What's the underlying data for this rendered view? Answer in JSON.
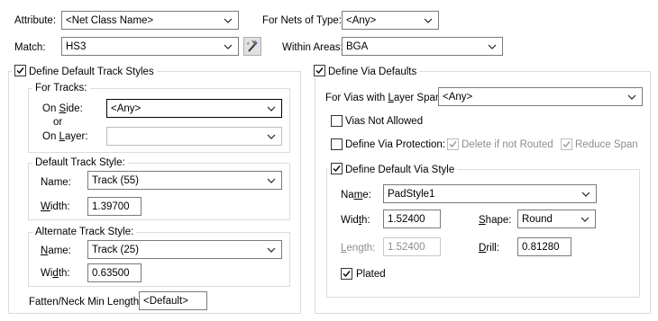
{
  "top": {
    "attribute_label": "Attribute:",
    "attribute_value": "<Net Class Name>",
    "nets_type_label": "For Nets of Type:",
    "nets_type_value": "<Any>",
    "match_label": "Match:",
    "match_value": "HS3",
    "within_areas_label": "Within Areas:",
    "within_areas_value": "BGA"
  },
  "track": {
    "group_label": "Define Default Track Styles",
    "group_checked": true,
    "for_tracks_label": "For Tracks:",
    "on_side_label": "On Side:",
    "on_side_value": "<Any>",
    "or_label": "or",
    "on_layer_label": "On Layer:",
    "on_layer_value": "",
    "default_style_label": "Default Track Style:",
    "default_name_label": "Name:",
    "default_name_value": "Track (55)",
    "default_width_label": "Width:",
    "default_width_value": "1.39700",
    "alt_style_label": "Alternate Track Style:",
    "alt_name_label": "Name:",
    "alt_name_value": "Track (25)",
    "alt_width_label": "Width:",
    "alt_width_value": "0.63500",
    "fatten_label": "Fatten/Neck Min Length:",
    "fatten_value": "<Default>"
  },
  "via": {
    "group_label": "Define Via Defaults",
    "group_checked": true,
    "span_label": "For Vias with Layer Span:",
    "span_value": "<Any>",
    "not_allowed_label": "Vias Not Allowed",
    "not_allowed_checked": false,
    "protection_label": "Define Via Protection:",
    "protection_checked": false,
    "delete_label": "Delete if not Routed",
    "delete_checked": true,
    "reduce_label": "Reduce Span",
    "reduce_checked": true,
    "default_style_label": "Define Default Via Style",
    "default_style_checked": true,
    "name_label": "Name:",
    "name_value": "PadStyle1",
    "width_label": "Width:",
    "width_value": "1.52400",
    "shape_label": "Shape:",
    "shape_value": "Round",
    "length_label": "Length:",
    "length_value": "1.52400",
    "drill_label": "Drill:",
    "drill_value": "0.81280",
    "plated_label": "Plated",
    "plated_checked": true
  },
  "icons": {
    "dropdown": "chevron-down-icon",
    "wand": "magic-wand-icon",
    "check": "checkmark-icon"
  }
}
